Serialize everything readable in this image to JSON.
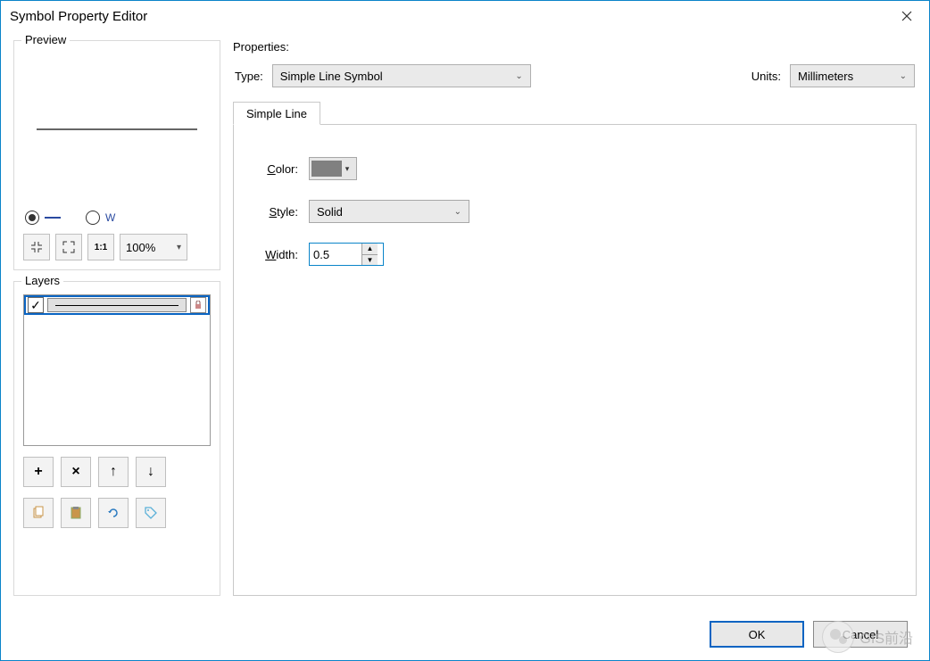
{
  "window": {
    "title": "Symbol Property Editor"
  },
  "preview": {
    "label": "Preview",
    "zoom_value": "100%",
    "radio_line_checked": true,
    "radio_zigzag_checked": false,
    "buttons": {
      "collapse": "collapse-icon",
      "expand": "expand-icon",
      "one_to_one": "1:1"
    }
  },
  "layers": {
    "label": "Layers",
    "items": [
      {
        "checked": true,
        "locked": false
      }
    ],
    "buttons": {
      "add": "+",
      "remove": "×",
      "up": "↑",
      "down": "↓"
    },
    "buttons2": {
      "copy": "copy-icon",
      "paste": "paste-icon",
      "reset": "reset-icon",
      "tag": "tag-icon"
    }
  },
  "properties": {
    "label": "Properties:",
    "type_label": "Type:",
    "type_value": "Simple Line Symbol",
    "units_label": "Units:",
    "units_value": "Millimeters",
    "tab_label": "Simple Line",
    "color_label": "Color:",
    "color_value": "#808080",
    "style_label": "Style:",
    "style_value": "Solid",
    "width_label": "Width:",
    "width_value": "0.5"
  },
  "footer": {
    "ok": "OK",
    "cancel": "Cancel"
  },
  "watermark": "GIS前沿"
}
